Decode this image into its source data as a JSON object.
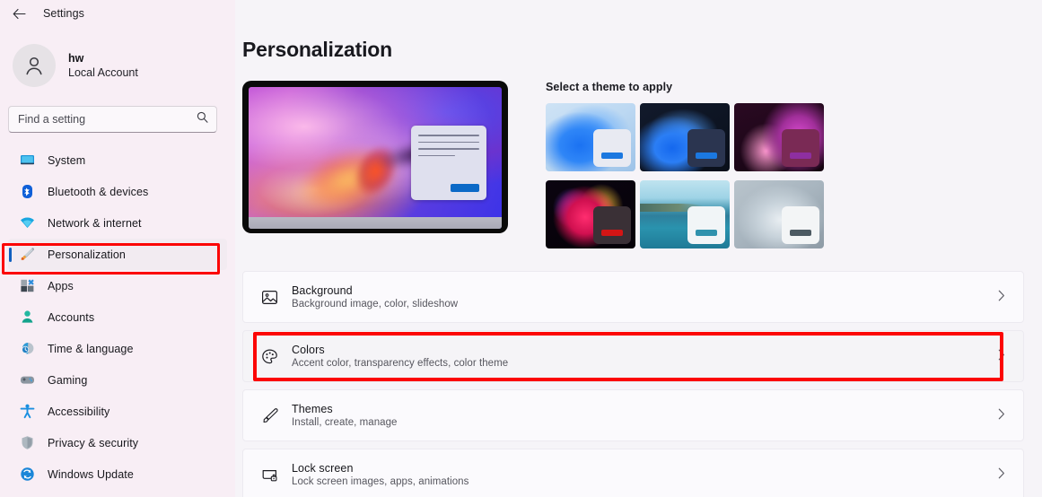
{
  "titlebar": {
    "back_label": "Back",
    "back_icon": "arrow-left-icon",
    "title": "Settings"
  },
  "account": {
    "avatar_icon": "person-avatar-icon",
    "name": "hw",
    "type": "Local Account"
  },
  "search": {
    "placeholder": "Find a setting",
    "value": "",
    "icon": "search-icon"
  },
  "sidebar": {
    "items": [
      {
        "label": "System",
        "icon": "monitor-icon",
        "selected": false
      },
      {
        "label": "Bluetooth & devices",
        "icon": "bluetooth-icon",
        "selected": false
      },
      {
        "label": "Network & internet",
        "icon": "wifi-icon",
        "selected": false
      },
      {
        "label": "Personalization",
        "icon": "paintbrush-icon",
        "selected": true
      },
      {
        "label": "Apps",
        "icon": "apps-icon",
        "selected": false
      },
      {
        "label": "Accounts",
        "icon": "account-icon",
        "selected": false
      },
      {
        "label": "Time & language",
        "icon": "clock-globe-icon",
        "selected": false
      },
      {
        "label": "Gaming",
        "icon": "gamepad-icon",
        "selected": false
      },
      {
        "label": "Accessibility",
        "icon": "accessibility-icon",
        "selected": false
      },
      {
        "label": "Privacy & security",
        "icon": "shield-icon",
        "selected": false
      },
      {
        "label": "Windows Update",
        "icon": "update-icon",
        "selected": false
      }
    ]
  },
  "main": {
    "page_title": "Personalization",
    "preview": {
      "name": "current-theme-preview",
      "window_button_color": "#0b69c7"
    },
    "themes": {
      "label": "Select a theme to apply",
      "items": [
        {
          "name": "windows-light-bloom",
          "accent": "#1b78e0",
          "window": "#e8eaf2"
        },
        {
          "name": "windows-dark-bloom",
          "accent": "#1b78e0",
          "window": "#2b3550"
        },
        {
          "name": "glow-purple",
          "accent": "#7b2f8e",
          "window": "#7a2a55"
        },
        {
          "name": "captured-motion-flower",
          "accent": "#d41515",
          "window": "#3a3036"
        },
        {
          "name": "sunrise-lake",
          "accent": "#2f92ad",
          "window": "#f1f5f7"
        },
        {
          "name": "flow-light",
          "accent": "#4c5a62",
          "window": "#f3f5f6"
        }
      ]
    },
    "cards": [
      {
        "title": "Background",
        "subtitle": "Background image, color, slideshow",
        "icon": "image-icon",
        "chevron": "chevron-right-icon",
        "highlighted": false
      },
      {
        "title": "Colors",
        "subtitle": "Accent color, transparency effects, color theme",
        "icon": "palette-icon",
        "chevron": "chevron-right-icon",
        "highlighted": true
      },
      {
        "title": "Themes",
        "subtitle": "Install, create, manage",
        "icon": "paintbrush-icon",
        "chevron": "chevron-right-icon",
        "highlighted": false
      },
      {
        "title": "Lock screen",
        "subtitle": "Lock screen images, apps, animations",
        "icon": "lock-screen-icon",
        "chevron": "chevron-right-icon",
        "highlighted": false
      }
    ]
  },
  "annotations": {
    "highlight_color": "#fc0505",
    "sidebar_target": "Personalization",
    "card_target": "Colors"
  },
  "colors": {
    "sidebar_bg": "#f8eef5",
    "main_bg": "#f6f4f8",
    "card_bg": "#fbfafd",
    "selection_bar": "#0f5fbf"
  }
}
